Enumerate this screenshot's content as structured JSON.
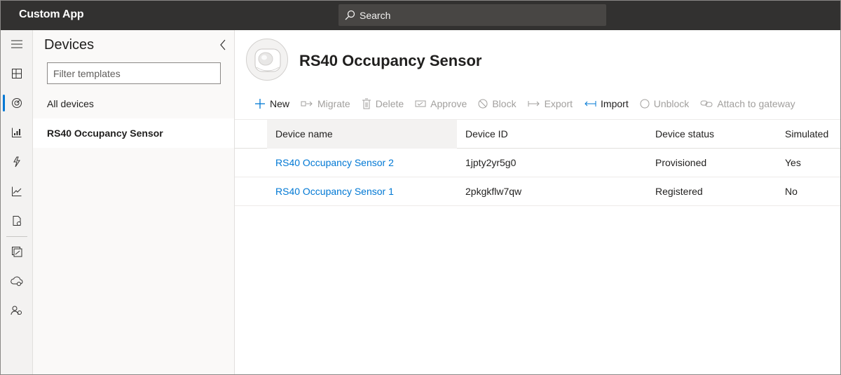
{
  "app": {
    "title": "Custom App"
  },
  "search": {
    "label": "Search"
  },
  "rail": {
    "items": [
      {
        "icon": "hamburger-icon"
      },
      {
        "icon": "dashboard-icon"
      },
      {
        "icon": "devices-icon",
        "active": true
      },
      {
        "icon": "device-groups-icon"
      },
      {
        "icon": "rules-icon"
      },
      {
        "icon": "analytics-icon"
      },
      {
        "icon": "jobs-icon"
      },
      {
        "icon": "device-templates-icon"
      },
      {
        "icon": "data-export-icon"
      },
      {
        "icon": "administration-icon"
      }
    ]
  },
  "panel": {
    "title": "Devices",
    "filter_placeholder": "Filter templates",
    "items": [
      {
        "label": "All devices"
      },
      {
        "label": "RS40 Occupancy Sensor",
        "selected": true
      }
    ]
  },
  "main": {
    "title": "RS40 Occupancy Sensor",
    "commands": [
      {
        "label": "New",
        "icon": "plus-icon",
        "enabled": true
      },
      {
        "label": "Migrate",
        "icon": "migrate-icon",
        "enabled": false
      },
      {
        "label": "Delete",
        "icon": "trash-icon",
        "enabled": false
      },
      {
        "label": "Approve",
        "icon": "approve-icon",
        "enabled": false
      },
      {
        "label": "Block",
        "icon": "block-icon",
        "enabled": false
      },
      {
        "label": "Export",
        "icon": "export-icon",
        "enabled": false
      },
      {
        "label": "Import",
        "icon": "import-icon",
        "enabled": true
      },
      {
        "label": "Unblock",
        "icon": "unblock-icon",
        "enabled": false
      },
      {
        "label": "Attach to gateway",
        "icon": "link-icon",
        "enabled": false
      }
    ],
    "table": {
      "columns": [
        "Device name",
        "Device ID",
        "Device status",
        "Simulated"
      ],
      "rows": [
        [
          "RS40 Occupancy Sensor 2",
          "1jpty2yr5g0",
          "Provisioned",
          "Yes"
        ],
        [
          "RS40 Occupancy Sensor 1",
          "2pkgkflw7qw",
          "Registered",
          "No"
        ]
      ]
    }
  },
  "colors": {
    "accent": "#0078d4",
    "topbar": "#323130",
    "search_bg": "#484644"
  }
}
